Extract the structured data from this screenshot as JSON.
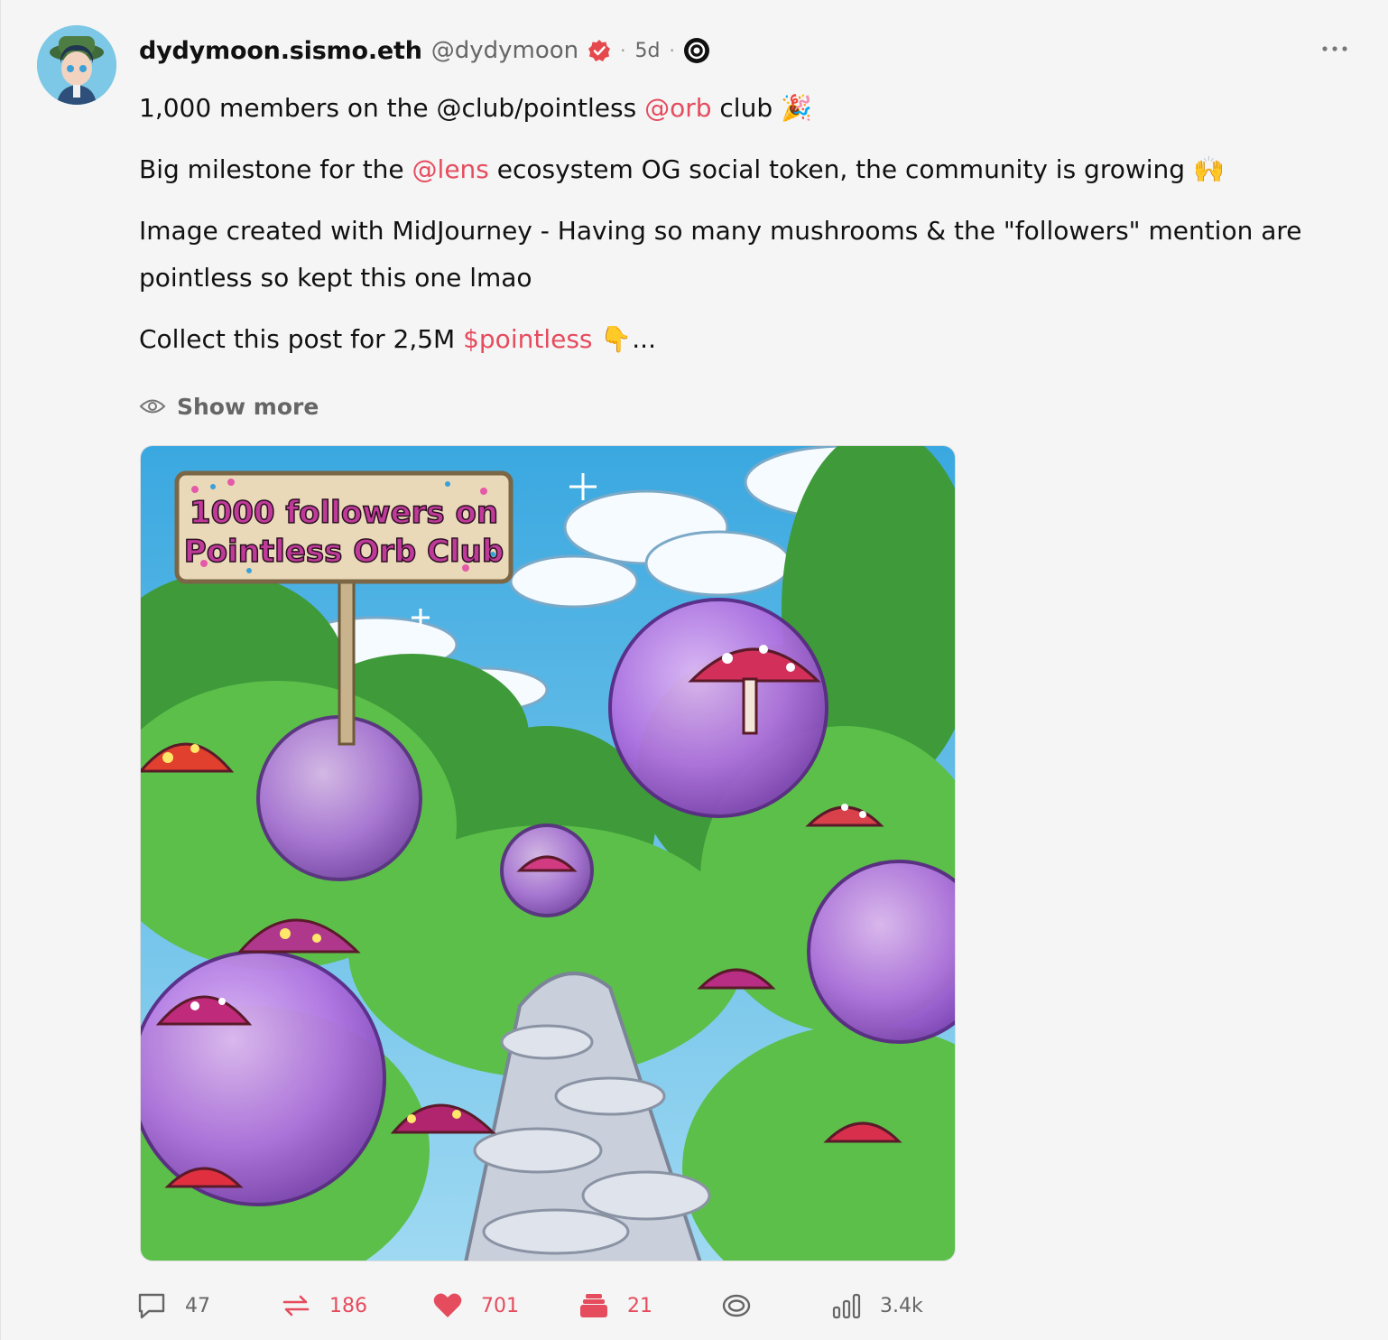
{
  "author": {
    "display_name": "dydymoon.sismo.eth",
    "handle": "@dydymoon",
    "age": "5d",
    "separator": "·"
  },
  "post": {
    "line1": {
      "pre": "1,000 members on the @club/pointless ",
      "mention": "@orb",
      "post": " club 🎉"
    },
    "line2": {
      "pre": "Big milestone for the ",
      "mention": "@lens",
      "post": " ecosystem OG social token, the community is growing 🙌"
    },
    "line3": "Image created with MidJourney - Having so many mushrooms & the \"followers\" mention are pointless so kept this one lmao",
    "line4": {
      "pre": "Collect this post for 2,5M ",
      "mention": "$pointless",
      "post": " 👇..."
    },
    "show_more": "Show more",
    "image_sign": {
      "line1": "1000 followers on",
      "line2": "Pointless Orb Club"
    }
  },
  "actions": {
    "comments": "47",
    "mirrors": "186",
    "likes": "701",
    "collects": "21",
    "views": "3.4k"
  },
  "colors": {
    "accent": "#e54c5e",
    "muted": "#666666",
    "background": "#f5f5f5"
  },
  "icons": [
    "verified-badge-icon",
    "app-source-icon",
    "more-icon",
    "eye-icon",
    "comment-icon",
    "mirror-icon",
    "heart-icon",
    "collect-icon",
    "act-icon",
    "views-icon"
  ]
}
